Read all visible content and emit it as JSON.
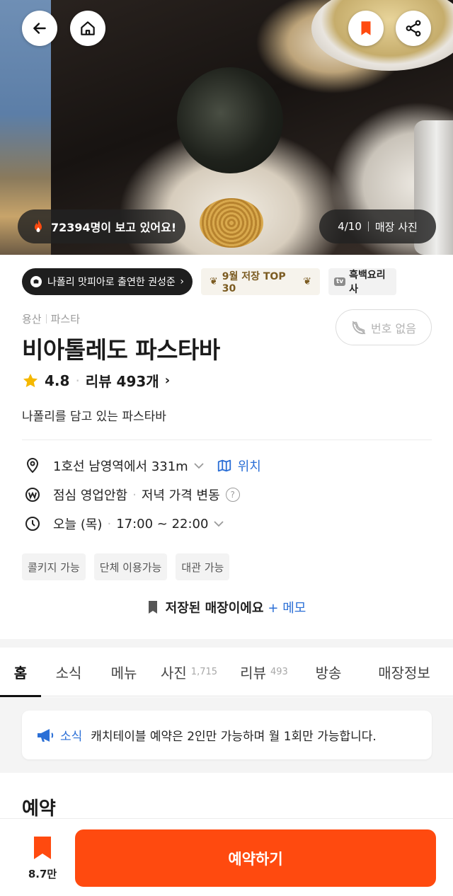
{
  "hero": {
    "viewers_text": "72394명이 보고 있어요!",
    "photo_index": "4/10",
    "photo_label": "매장 사진"
  },
  "tags": {
    "chef_tag": "나폴리 맛피아로 출연한 권성준",
    "ranking_tag": "9월 저장 TOP 30",
    "tv_badge": "tv",
    "tv_tag": "흑백요리사"
  },
  "restaurant": {
    "area": "용산",
    "category": "파스타",
    "name": "비아톨레도 파스타바",
    "rating": "4.8",
    "review_label": "리뷰 493개",
    "description": "나폴리를 담고 있는 파스타바",
    "no_phone_label": "번호 없음"
  },
  "info": {
    "location": "1호선 남영역에서 331m",
    "location_link": "위치",
    "lunch": "점심 영업안함",
    "dinner_price": "저녁 가격 변동",
    "help": "?",
    "day": "오늘 (목)",
    "hours": "17:00 ~ 22:00"
  },
  "chips": [
    "콜키지 가능",
    "단체 이용가능",
    "대관 가능"
  ],
  "saved": {
    "text": "저장된 매장이에요",
    "memo": "+ 메모"
  },
  "tabs": [
    {
      "label": "홈",
      "count": ""
    },
    {
      "label": "소식",
      "count": ""
    },
    {
      "label": "메뉴",
      "count": ""
    },
    {
      "label": "사진",
      "count": "1,715"
    },
    {
      "label": "리뷰",
      "count": "493"
    },
    {
      "label": "방송",
      "count": ""
    },
    {
      "label": "매장정보",
      "count": ""
    }
  ],
  "notice": {
    "tag": "소식",
    "text": "캐치테이블 예약은 2인만 가능하며 월 1회만 가능합니다."
  },
  "section_title": "예약",
  "bottom": {
    "save_count": "8.7만",
    "reserve_label": "예약하기"
  },
  "colors": {
    "accent": "#ff4a0f",
    "link": "#2b6fd6",
    "star": "#f5b800"
  },
  "icons": {
    "back": "arrow-left-icon",
    "home": "home-icon",
    "bookmark": "bookmark-icon",
    "share": "share-icon",
    "fire": "fire-icon",
    "star": "star-icon",
    "location": "map-pin-icon",
    "price": "won-icon",
    "clock": "clock-icon",
    "map": "map-icon",
    "megaphone": "megaphone-icon"
  }
}
